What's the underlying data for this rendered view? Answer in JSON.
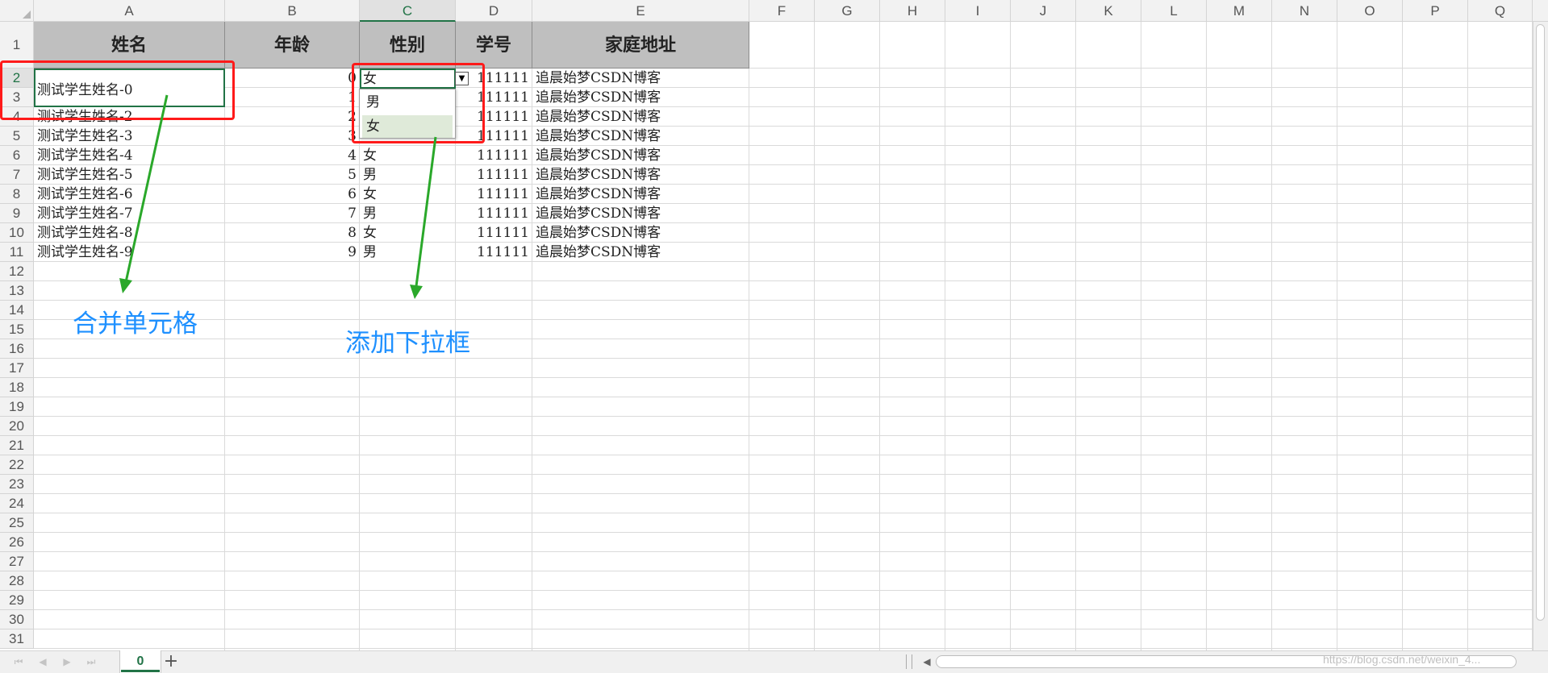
{
  "columns": [
    "A",
    "B",
    "C",
    "D",
    "E",
    "F",
    "G",
    "H",
    "I",
    "J",
    "K",
    "L",
    "M",
    "N",
    "O",
    "P",
    "Q"
  ],
  "rows": [
    "1",
    "2",
    "3",
    "4",
    "5",
    "6",
    "7",
    "8",
    "9",
    "10",
    "11",
    "12",
    "13",
    "14",
    "15",
    "16",
    "17",
    "18",
    "19",
    "20",
    "21",
    "22",
    "23",
    "24",
    "25",
    "26",
    "27",
    "28",
    "29",
    "30",
    "31"
  ],
  "table_header": {
    "name": "姓名",
    "age": "年龄",
    "gender": "性别",
    "student_id": "学号",
    "address": "家庭地址"
  },
  "merged_name": "测试学生姓名-0",
  "data_rows": [
    {
      "name": "",
      "age": "0",
      "gender": "女",
      "student_id": "111111",
      "address": "追晨始梦CSDN博客"
    },
    {
      "name": "",
      "age": "1",
      "gender": "",
      "student_id": "111111",
      "address": "追晨始梦CSDN博客"
    },
    {
      "name": "测试学生姓名-2",
      "age": "2",
      "gender": "",
      "student_id": "111111",
      "address": "追晨始梦CSDN博客"
    },
    {
      "name": "测试学生姓名-3",
      "age": "3",
      "gender": "",
      "student_id": "111111",
      "address": "追晨始梦CSDN博客"
    },
    {
      "name": "测试学生姓名-4",
      "age": "4",
      "gender": "女",
      "student_id": "111111",
      "address": "追晨始梦CSDN博客"
    },
    {
      "name": "测试学生姓名-5",
      "age": "5",
      "gender": "男",
      "student_id": "111111",
      "address": "追晨始梦CSDN博客"
    },
    {
      "name": "测试学生姓名-6",
      "age": "6",
      "gender": "女",
      "student_id": "111111",
      "address": "追晨始梦CSDN博客"
    },
    {
      "name": "测试学生姓名-7",
      "age": "7",
      "gender": "男",
      "student_id": "111111",
      "address": "追晨始梦CSDN博客"
    },
    {
      "name": "测试学生姓名-8",
      "age": "8",
      "gender": "女",
      "student_id": "111111",
      "address": "追晨始梦CSDN博客"
    },
    {
      "name": "测试学生姓名-9",
      "age": "9",
      "gender": "男",
      "student_id": "111111",
      "address": "追晨始梦CSDN博客"
    }
  ],
  "dropdown": {
    "options": [
      "男",
      "女"
    ],
    "highlighted": "女"
  },
  "annotations": {
    "merge": "合并单元格",
    "dropdown": "添加下拉框"
  },
  "sheet_tab": "0",
  "watermark": "https://blog.csdn.net/weixin_4...",
  "colors": {
    "annotation_blue": "#1e90ff",
    "annotation_red": "#ff1a1a",
    "arrow_green": "#2aa82a",
    "accent": "#217346",
    "header_fill": "#bfbfbf"
  }
}
